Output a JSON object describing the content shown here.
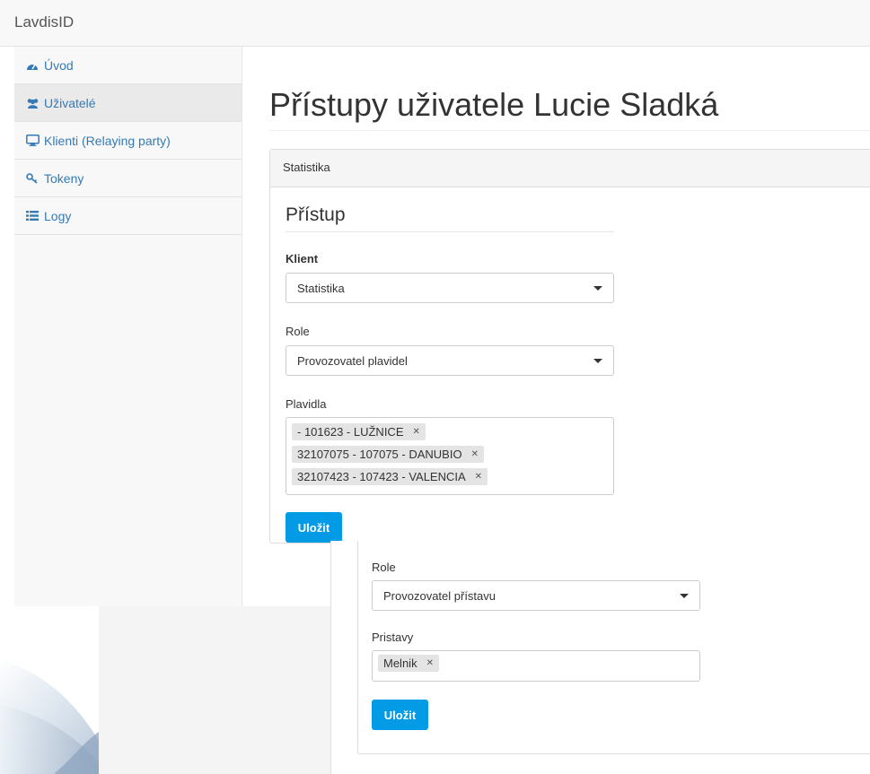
{
  "app": {
    "brand": "LavdisID"
  },
  "sidebar": {
    "items": [
      {
        "label": "Úvod",
        "icon": "dashboard-icon"
      },
      {
        "label": "Uživatelé",
        "icon": "users-icon"
      },
      {
        "label": "Klienti (Relaying party)",
        "icon": "monitor-icon"
      },
      {
        "label": "Tokeny",
        "icon": "key-icon"
      },
      {
        "label": "Logy",
        "icon": "list-icon"
      }
    ],
    "active": "Uživatelé"
  },
  "page": {
    "title": "Přístupy uživatele Lucie Sladká"
  },
  "panel": {
    "heading": "Statistika"
  },
  "form": {
    "legend": "Přístup",
    "client_label": "Klient",
    "client_value": "Statistika",
    "role_label": "Role",
    "role_value": "Provozovatel plavidel",
    "vessels_label": "Plavidla",
    "vessels": [
      "- 101623 - LUŽNICE",
      "32107075 - 107075 - DANUBIO",
      "32107423 - 107423 - VALENCIA"
    ],
    "save_label": "Uložit"
  },
  "overlay_form": {
    "role_label": "Role",
    "role_value": "Provozovatel přístavu",
    "ports_label": "Pristavy",
    "ports": [
      "Melnik"
    ],
    "save_label": "Uložit"
  },
  "colors": {
    "link": "#337ab7",
    "button": "#039be5",
    "navbar": "#f8f8f8"
  }
}
